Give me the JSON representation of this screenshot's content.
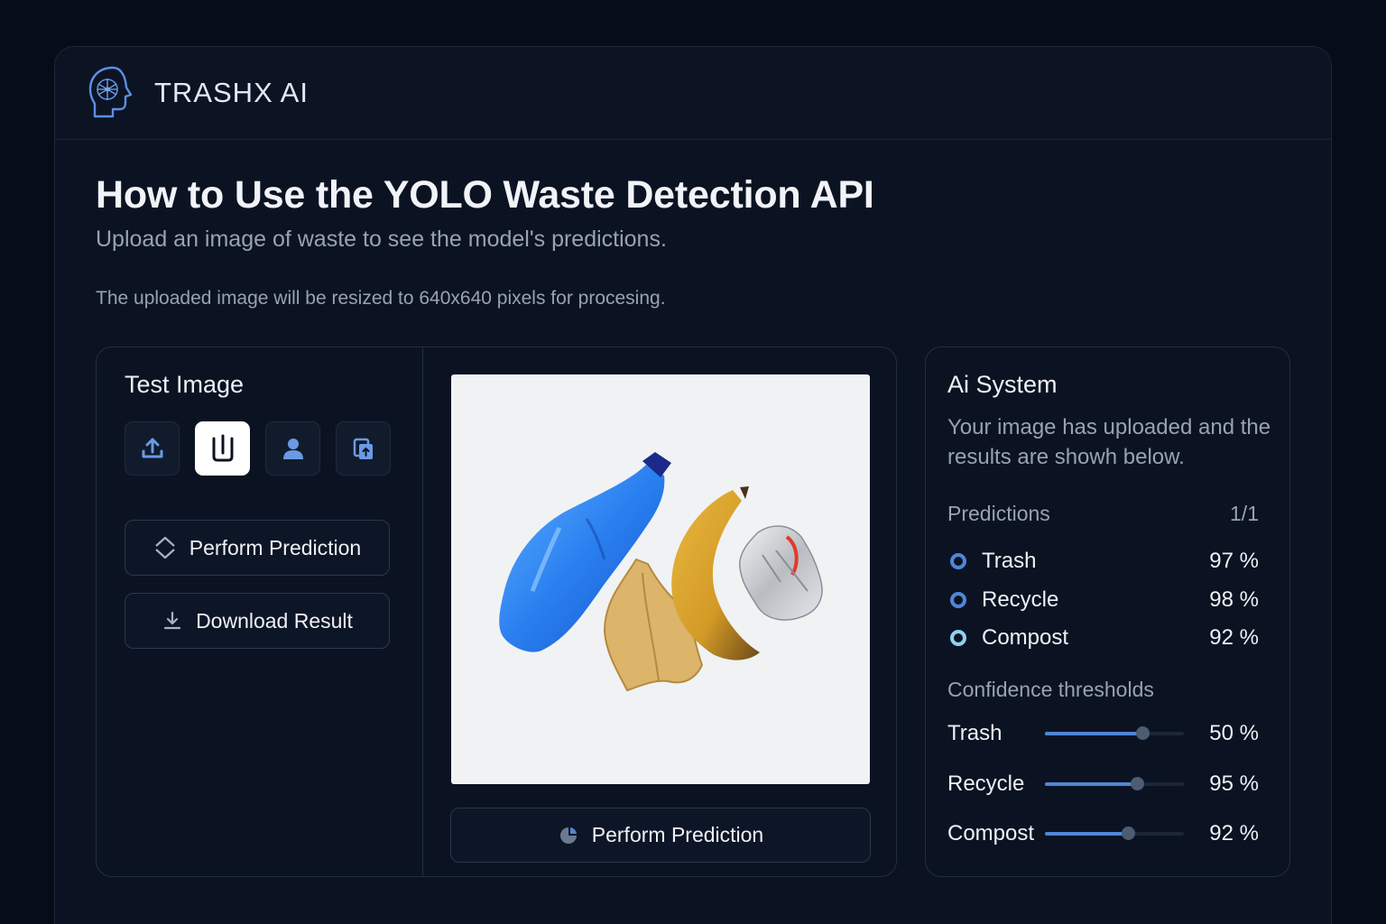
{
  "brand": {
    "name": "TRASHX AI",
    "logo_icon": "ai-head-icon"
  },
  "page": {
    "title": "How to Use the YOLO Waste Detection API",
    "subtitle": "Upload an image of waste to see the model's predictions.",
    "note": "The uploaded image will be resized to 640x640 pixels for procesing."
  },
  "test_panel": {
    "title": "Test Image",
    "tools": [
      {
        "icon": "upload-icon",
        "active": false
      },
      {
        "icon": "capture-icon",
        "active": true
      },
      {
        "icon": "user-icon",
        "active": false
      },
      {
        "icon": "paste-icon",
        "active": false
      }
    ],
    "perform_label": "Perform Prediction",
    "download_label": "Download Result",
    "perform_label_bottom": "Perform Prediction"
  },
  "ai_panel": {
    "title": "Ai System",
    "description": "Your image has uploaded and the results are showh below.",
    "predictions_label": "Predictions",
    "predictions_count": "1/1",
    "predictions": [
      {
        "label": "Trash",
        "value": "97 %",
        "color": "#4f86d6"
      },
      {
        "label": "Recycle",
        "value": "98 %",
        "color": "#4f86d6"
      },
      {
        "label": "Compost",
        "value": "92 %",
        "color": "#8fd0f0"
      }
    ],
    "thresholds_label": "Confidence thresholds",
    "thresholds": [
      {
        "label": "Trash",
        "value": "50 %",
        "level": 0.7
      },
      {
        "label": "Recycle",
        "value": "95 %",
        "level": 0.66
      },
      {
        "label": "Compost",
        "value": "92 %",
        "level": 0.6
      }
    ]
  },
  "colors": {
    "background": "#070d18",
    "panel": "#0b1322",
    "accent": "#4f86d6"
  }
}
